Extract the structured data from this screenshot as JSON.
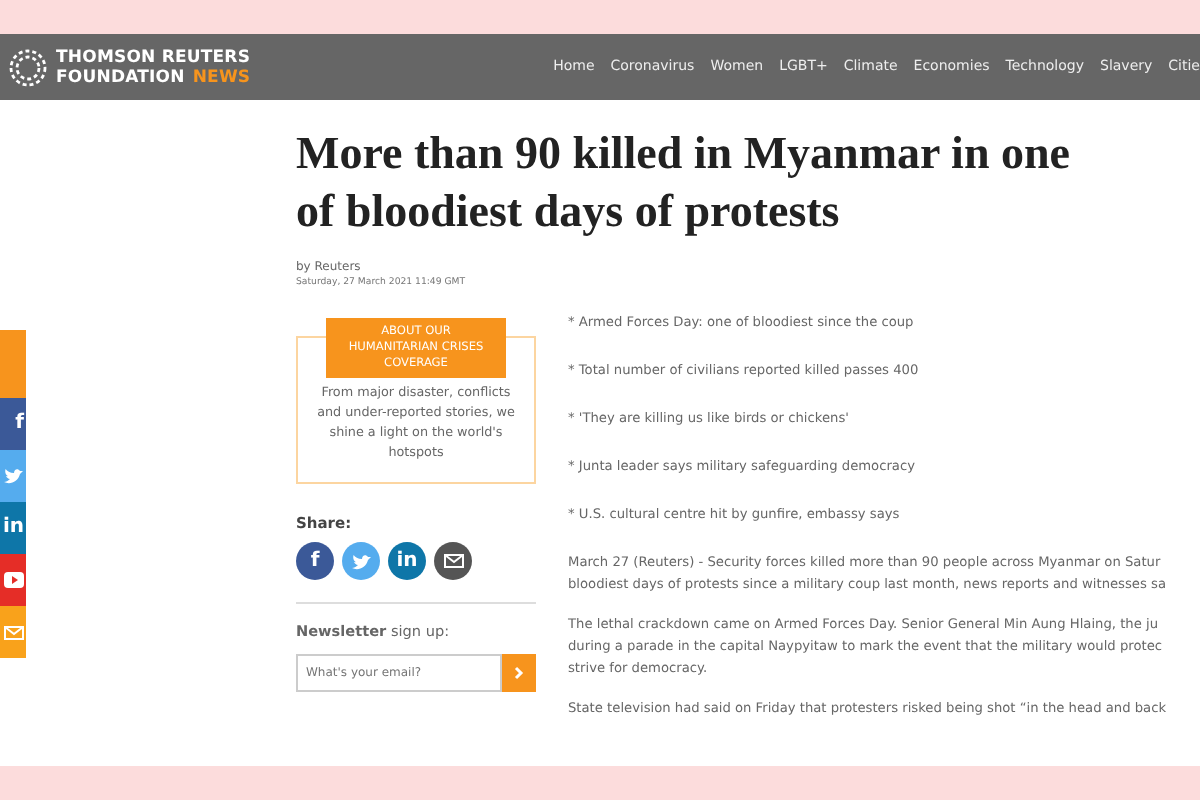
{
  "header": {
    "logo_line1": "THOMSON REUTERS",
    "logo_line2": "FOUNDATION",
    "logo_accent": "NEWS",
    "nav": [
      {
        "label": "Home"
      },
      {
        "label": "Coronavirus"
      },
      {
        "label": "Women"
      },
      {
        "label": "LGBT+"
      },
      {
        "label": "Climate"
      },
      {
        "label": "Economies"
      },
      {
        "label": "Technology"
      },
      {
        "label": "Slavery"
      },
      {
        "label": "Citie"
      }
    ]
  },
  "article": {
    "title": "More than 90 killed in Myanmar in one of bloodiest days of protests",
    "byline": "by Reuters",
    "date": "Saturday, 27 March 2021 11:49 GMT",
    "bullets": [
      "* Armed Forces Day: one of bloodiest since the coup",
      "* Total number of civilians reported killed passes 400",
      "* 'They are killing us like birds or chickens'",
      "* Junta leader says military safeguarding democracy",
      "* U.S. cultural centre hit by gunfire, embassy says"
    ],
    "paragraphs": [
      {
        "lines": [
          "March 27 (Reuters) - Security forces killed more than 90 people across Myanmar on Satur",
          "bloodiest days of protests since a military coup last month, news reports and witnesses sa"
        ]
      },
      {
        "lines": [
          "The lethal crackdown came on Armed Forces Day. Senior General Min Aung Hlaing, the ju",
          "during a parade in the capital Naypyitaw to mark the event that the military would protec",
          "strive for democracy."
        ]
      },
      {
        "lines": [
          "State television had said on Friday that protesters risked being shot “in the head and back"
        ]
      }
    ]
  },
  "promo": {
    "heading": "ABOUT OUR HUMANITARIAN CRISES COVERAGE",
    "text": "From major disaster, conflicts and under-reported stories, we shine a light on the world's hotspots"
  },
  "share": {
    "label": "Share:",
    "buttons": [
      {
        "kind": "facebook",
        "glyph": "f"
      },
      {
        "kind": "twitter"
      },
      {
        "kind": "linkedin",
        "glyph": "in"
      },
      {
        "kind": "email"
      }
    ]
  },
  "newsletter": {
    "label": "**Newsletter** sign up:",
    "placeholder": "What's your email?"
  },
  "side_bar": [
    {
      "kind": "facebook",
      "glyph": "f"
    },
    {
      "kind": "twitter"
    },
    {
      "kind": "linkedin",
      "glyph": "in"
    },
    {
      "kind": "youtube"
    },
    {
      "kind": "email"
    }
  ]
}
